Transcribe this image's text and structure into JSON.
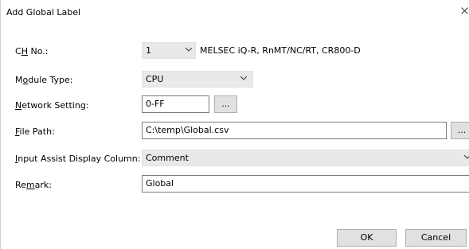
{
  "window": {
    "title": "Add Global Label"
  },
  "fields": {
    "ch_no": {
      "label_pre": "C",
      "label_ul": "H",
      "label_post": " No.:",
      "value": "1",
      "note": "MELSEC iQ-R, RnMT/NC/RT, CR800-D"
    },
    "module_type": {
      "label_pre": "M",
      "label_ul": "o",
      "label_post": "dule Type:",
      "value": "CPU"
    },
    "network_setting": {
      "label_pre": "",
      "label_ul": "N",
      "label_post": "etwork Setting:",
      "value": "0-FF",
      "button": "..."
    },
    "file_path": {
      "label_pre": "",
      "label_ul": "F",
      "label_post": "ile Path:",
      "value": "C:\\temp\\Global.csv",
      "button": "..."
    },
    "input_assist": {
      "label_pre": "",
      "label_ul": "I",
      "label_post": "nput Assist Display Column:",
      "value": "Comment"
    },
    "remark": {
      "label_pre": "Re",
      "label_ul": "m",
      "label_post": "ark:",
      "value": "Global"
    }
  },
  "buttons": {
    "ok": "OK",
    "cancel": "Cancel"
  }
}
